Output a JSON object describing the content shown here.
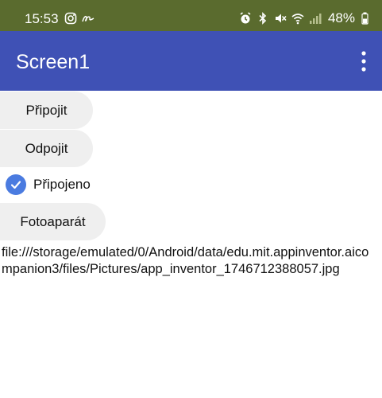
{
  "status_bar": {
    "time": "15:53",
    "battery_percent": "48%",
    "background_color": "#5a6b2e",
    "left_icons": [
      "instagram-icon",
      "signature-icon"
    ],
    "right_icons": [
      "alarm-icon",
      "bluetooth-icon",
      "mute-icon",
      "wifi-icon",
      "signal-icon",
      "battery-icon"
    ]
  },
  "app_bar": {
    "title": "Screen1",
    "background_color": "#3f51b5",
    "menu_icon": "more-vert-icon"
  },
  "content": {
    "connect_button": "Připojit",
    "disconnect_button": "Odpojit",
    "connected_checkbox": {
      "label": "Připojeno",
      "checked": true
    },
    "camera_button": "Fotoaparát",
    "file_path": "file:///storage/emulated/0/Android/data/edu.mit.appinventor.aicompanion3/files/Pictures/app_inventor_1746712388057.jpg"
  }
}
